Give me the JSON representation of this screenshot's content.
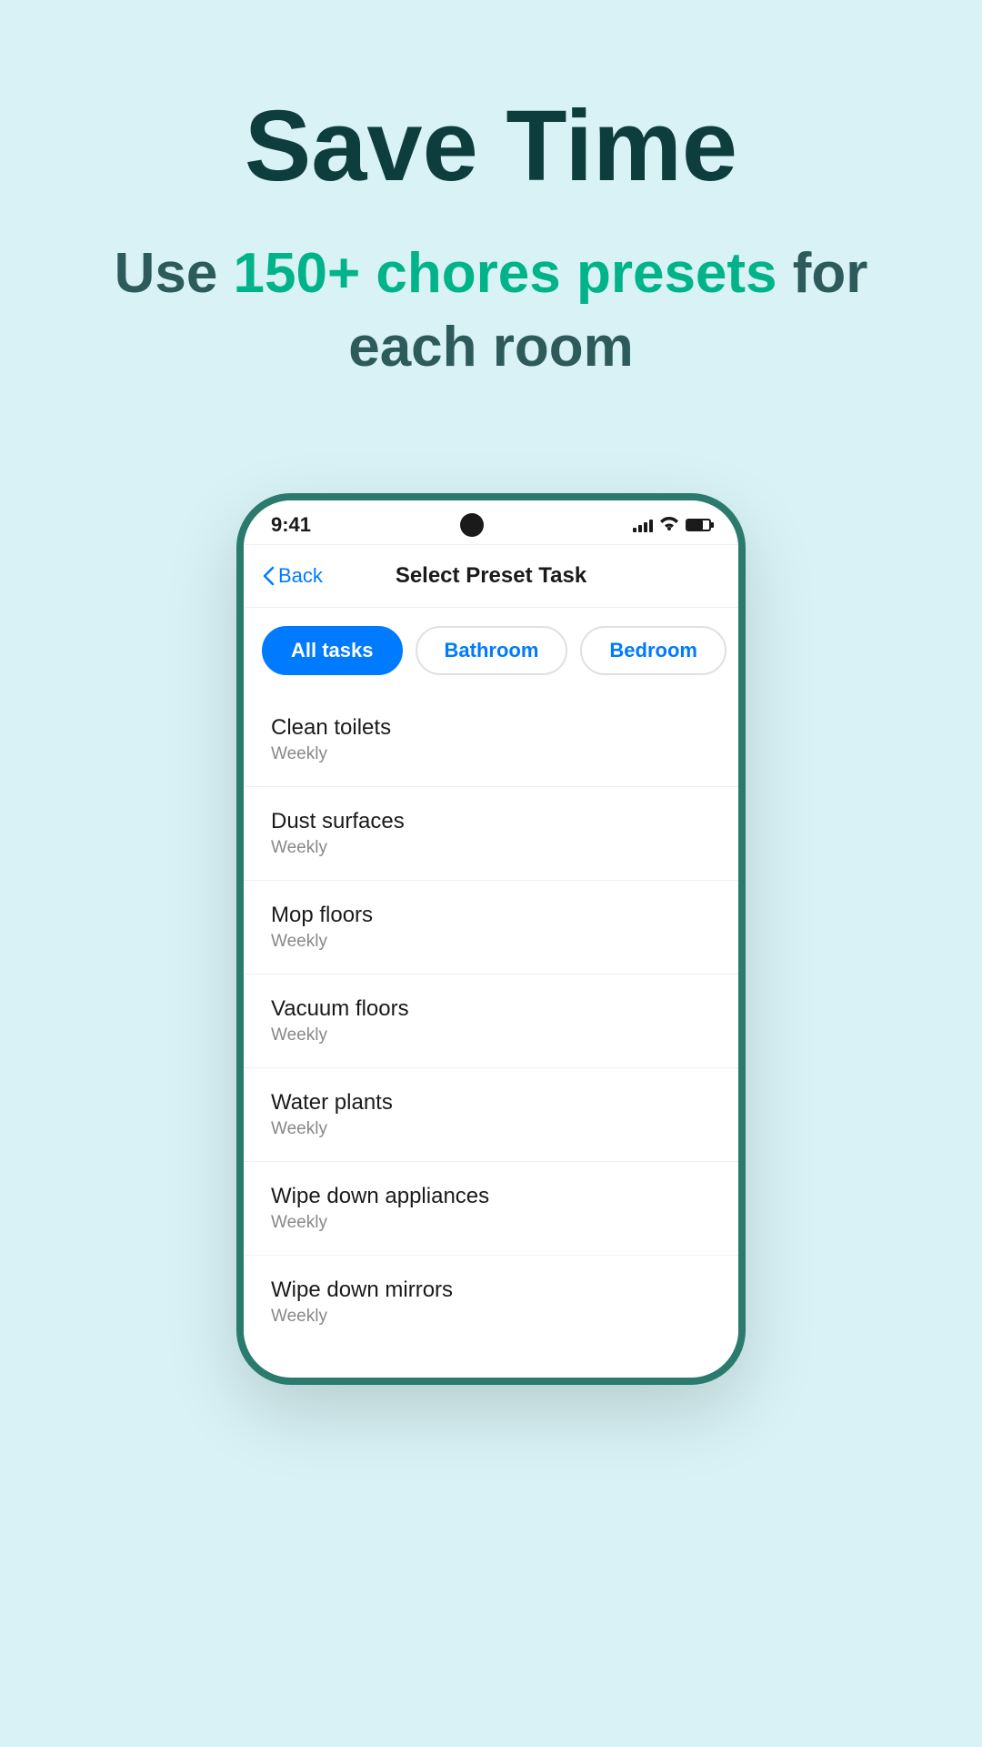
{
  "hero": {
    "title": "Save Time",
    "subtitle_plain": "Use ",
    "subtitle_highlight": "150+ chores presets",
    "subtitle_end": " for each room"
  },
  "phone": {
    "time": "9:41",
    "nav_back_label": "Back",
    "nav_title": "Select Preset Task",
    "tabs": [
      {
        "label": "All tasks",
        "active": true
      },
      {
        "label": "Bathroom",
        "active": false
      },
      {
        "label": "Bedroom",
        "active": false
      }
    ],
    "tasks": [
      {
        "name": "Clean toilets",
        "frequency": "Weekly"
      },
      {
        "name": "Dust surfaces",
        "frequency": "Weekly"
      },
      {
        "name": "Mop floors",
        "frequency": "Weekly"
      },
      {
        "name": "Vacuum floors",
        "frequency": "Weekly"
      },
      {
        "name": "Water plants",
        "frequency": "Weekly"
      },
      {
        "name": "Wipe down appliances",
        "frequency": "Weekly"
      },
      {
        "name": "Wipe down mirrors",
        "frequency": "Weekly"
      }
    ]
  }
}
